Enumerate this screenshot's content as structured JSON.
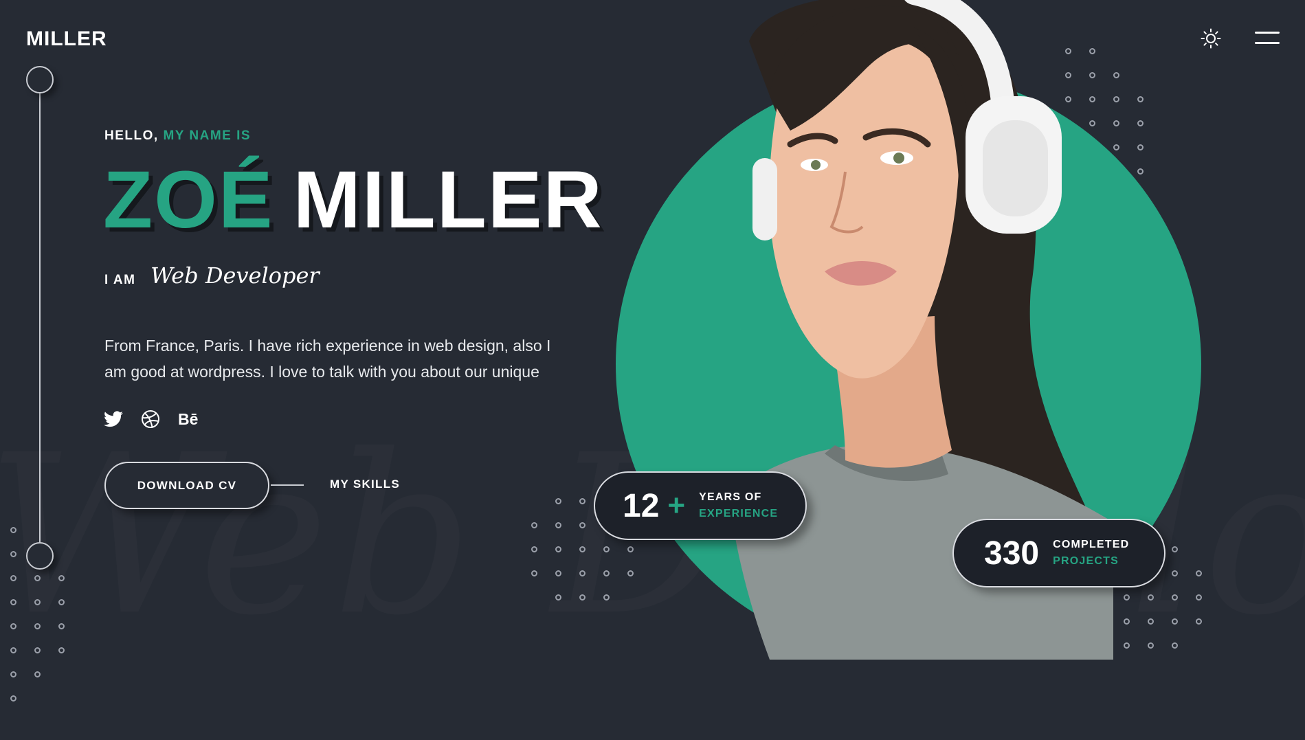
{
  "header": {
    "logo": "MILLER",
    "theme_icon": "sun-icon",
    "menu_icon": "menu-icon"
  },
  "hero": {
    "greeting_prefix": "HELLO,",
    "greeting_accent": "MY NAME IS",
    "first_name": "ZOÉ",
    "last_name": "MILLER",
    "role_prefix": "I AM",
    "role": "Web Developer",
    "intro": "From France, Paris. I have rich experience in web design, also I am good at wordpress. I love to talk with you about our unique",
    "watermark": "Web Developer"
  },
  "socials": [
    {
      "name": "twitter",
      "icon": "twitter-icon"
    },
    {
      "name": "dribbble",
      "icon": "dribbble-icon"
    },
    {
      "name": "behance",
      "icon": "behance-icon",
      "label": "Bē"
    }
  ],
  "actions": {
    "download_cv": "DOWNLOAD CV",
    "my_skills": "MY SKILLS"
  },
  "stats": {
    "experience": {
      "number": "12",
      "suffix": "+",
      "line1": "YEARS OF",
      "line2": "EXPERIENCE"
    },
    "projects": {
      "number": "330",
      "line1": "COMPLETED",
      "line2": "PROJECTS"
    }
  },
  "colors": {
    "background": "#262b34",
    "accent": "#26a483",
    "text": "#ffffff"
  }
}
